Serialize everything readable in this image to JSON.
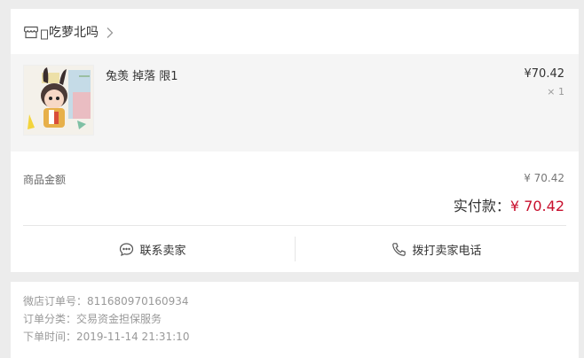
{
  "shop": {
    "icon": "store-icon",
    "name": "吃萝北吗",
    "chevron": "chevron-right-icon"
  },
  "goods": {
    "image": "product-thumbnail",
    "title": "兔羡 掉落 限1",
    "price": "¥70.42",
    "qty": "× 1"
  },
  "summary": {
    "subtotal_label": "商品金额",
    "subtotal_value": "¥ 70.42",
    "paid_label": "实付款：",
    "paid_value": "¥ 70.42"
  },
  "actions": {
    "contact_label": "联系卖家",
    "contact_icon": "chat-bubble-icon",
    "call_label": "拨打卖家电话",
    "call_icon": "phone-icon"
  },
  "info": {
    "order_no": "微店订单号：811680970160934",
    "order_type": "订单分类：交易资金担保服务",
    "order_time": "下单时间：2019-11-14 21:31:10"
  },
  "colors": {
    "accent_red": "#c8102e",
    "background": "#ececec",
    "goods_bg": "#f5f5f5"
  }
}
